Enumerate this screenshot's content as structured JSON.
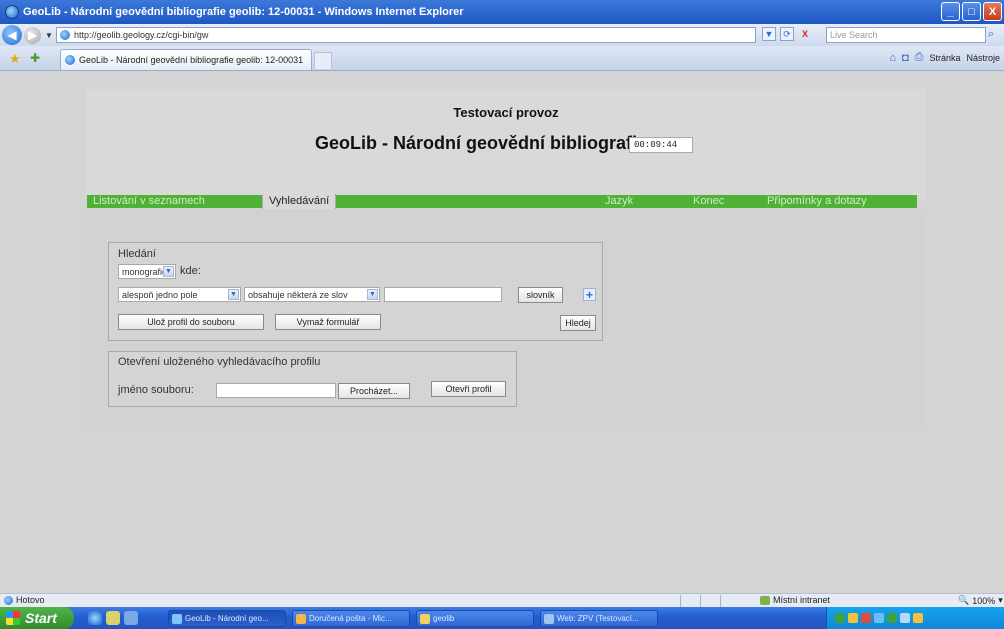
{
  "window": {
    "title": "GeoLib - Národní geovědní bibliografie geolib: 12-00031 - Windows Internet Explorer",
    "buttons": [
      "_",
      "□",
      "X"
    ]
  },
  "address_bar": {
    "url": "http://geolib.geology.cz/cgi-bin/gw",
    "refresh_icon": "refresh-icon",
    "stop_label": "X",
    "search_placeholder": "Live Search"
  },
  "tabs": {
    "active_tab": "GeoLib - Národní geovědní bibliografie geolib: 12-00031"
  },
  "command_bar": {
    "page_label": "Stránka",
    "tools_label": "Nástroje"
  },
  "page": {
    "test_banner": "Testovací provoz",
    "title": "GeoLib - Národní geovědní bibliografie",
    "clock": "00:09:44",
    "menu": [
      {
        "label": "Listování v seznamech"
      },
      {
        "label": "Vyhledávání",
        "active": true
      },
      {
        "label": "Jazyk"
      },
      {
        "label": "Konec"
      },
      {
        "label": "Připomínky a dotazy"
      }
    ],
    "search": {
      "legend": "Hledání",
      "doc_type": "monografie",
      "where_label": "kde:",
      "field_select": "alespoň jedno pole",
      "condition_select": "obsahuje některá ze slov",
      "term_value": "",
      "dictionary_button": "slovník",
      "plus_label": "+",
      "save_profile_button": "Ulož profil do souboru",
      "clear_form_button": "Vymaž formulář",
      "search_button": "Hledej"
    },
    "open_profile": {
      "legend": "Otevření uloženého vyhledávacího profilu",
      "file_label": "jméno souboru:",
      "browse_button": "Procházet...",
      "open_button": "Otevři profil"
    }
  },
  "status_bar": {
    "status": "Hotovo",
    "zone": "Místní intranet",
    "zoom": "100%"
  },
  "taskbar": {
    "start_label": "Start",
    "items": [
      {
        "label": "GeoLib - Národní geo...",
        "active": true
      },
      {
        "label": "Doručená pošta - Mic..."
      },
      {
        "label": "geolib"
      },
      {
        "label": "Web: ZPV (Testovací..."
      }
    ],
    "colors": {
      "taskbar": "#2454c2",
      "start": "#3fa23b",
      "tray": "#0f87d6",
      "menu_green": "#4fb135"
    }
  }
}
